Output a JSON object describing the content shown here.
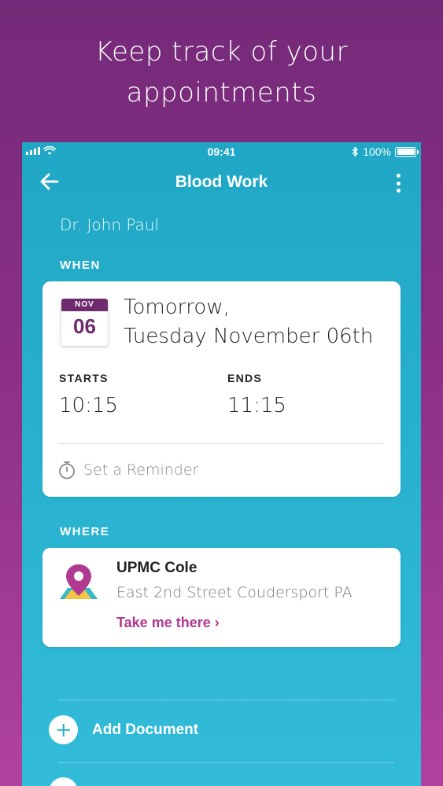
{
  "headline": {
    "line1": "Keep track of your",
    "line2": "appointments"
  },
  "status_bar": {
    "time": "09:41",
    "battery": "100%"
  },
  "nav": {
    "title": "Blood Work"
  },
  "doctor": "Dr. John Paul",
  "when": {
    "label": "WHEN",
    "calendar": {
      "month": "NOV",
      "day": "06"
    },
    "date_line1": "Tomorrow,",
    "date_line2": "Tuesday November 06th",
    "starts_label": "STARTS",
    "starts_value": "10:15",
    "ends_label": "ENDS",
    "ends_value": "11:15",
    "reminder_label": "Set a Reminder"
  },
  "where": {
    "label": "WHERE",
    "name": "UPMC Cole",
    "address": "East 2nd Street Coudersport PA",
    "link": "Take me there ›"
  },
  "actions": [
    {
      "label": "Add Document",
      "icon": "plus-icon"
    },
    {
      "label": "",
      "icon": "plus-icon"
    }
  ],
  "colors": {
    "accent": "#b03a8f",
    "calendar": "#6e2c6e",
    "phone_background": "#28b2cf"
  }
}
